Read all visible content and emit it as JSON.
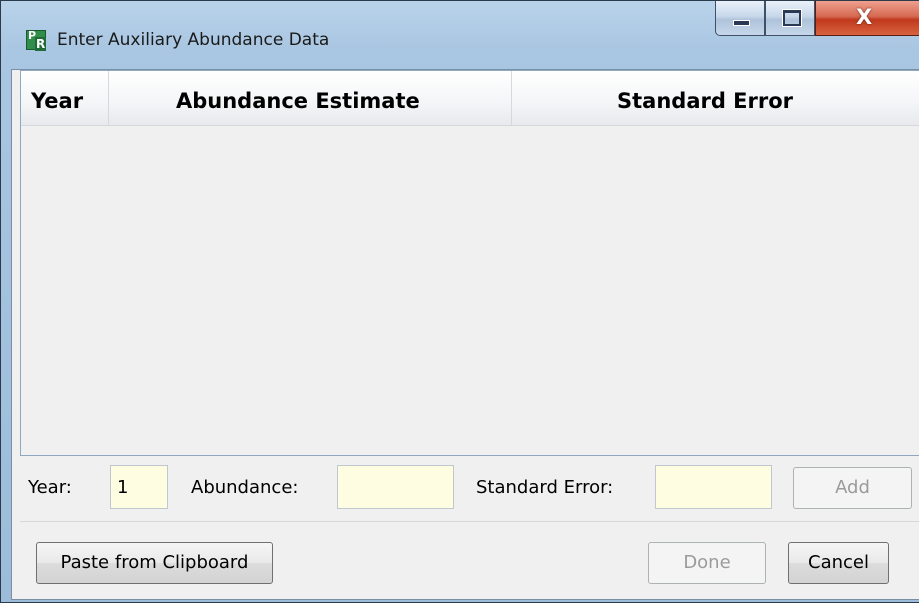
{
  "window": {
    "title": "Enter Auxiliary Abundance Data",
    "icon": "pr-app-icon",
    "icon_letters": {
      "p": "P",
      "r": "R"
    },
    "controls": [
      "minimize-icon",
      "maximize-icon",
      "close-icon"
    ],
    "close_glyph": "X"
  },
  "grid": {
    "columns": [
      "Year",
      "Abundance Estimate",
      "Standard Error"
    ],
    "rows": []
  },
  "entry": {
    "year_label": "Year:",
    "year_value": "1",
    "abundance_label": "Abundance:",
    "abundance_value": "",
    "se_label": "Standard Error:",
    "se_value": "",
    "add_label": "Add"
  },
  "footer": {
    "paste_label": "Paste from Clipboard",
    "done_label": "Done",
    "cancel_label": "Cancel"
  },
  "colors": {
    "input_bg": "#fffde1",
    "close_button": "#c0391d"
  }
}
